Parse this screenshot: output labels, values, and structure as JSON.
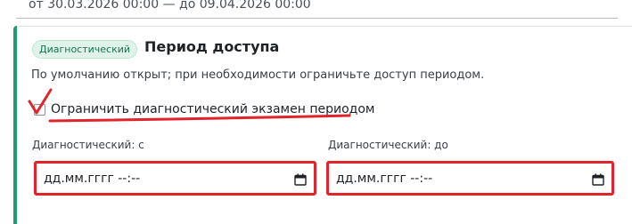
{
  "previous_range": {
    "text": "от 30.03.2026 00:00 — до 09.04.2026 00:00"
  },
  "card": {
    "badge": "Диагностический",
    "title": "Период доступа",
    "description": "По умолчанию открыт; при необходимости ограничьте доступ периодом.",
    "checkbox": {
      "label": "Ограничить диагностический экзамен периодом",
      "checked": false
    },
    "fields": {
      "from": {
        "label": "Диагностический: с",
        "value_placeholder": "дд.мм.гггг --:--",
        "icon": "calendar-icon"
      },
      "to": {
        "label": "Диагностический: до",
        "value_placeholder": "дд.мм.гггг --:--",
        "icon": "calendar-icon"
      }
    }
  },
  "colors": {
    "accent": "#1f9a73",
    "badge_bg": "#dff3ea",
    "badge_text": "#17734f",
    "annotation": "#e1242c"
  }
}
